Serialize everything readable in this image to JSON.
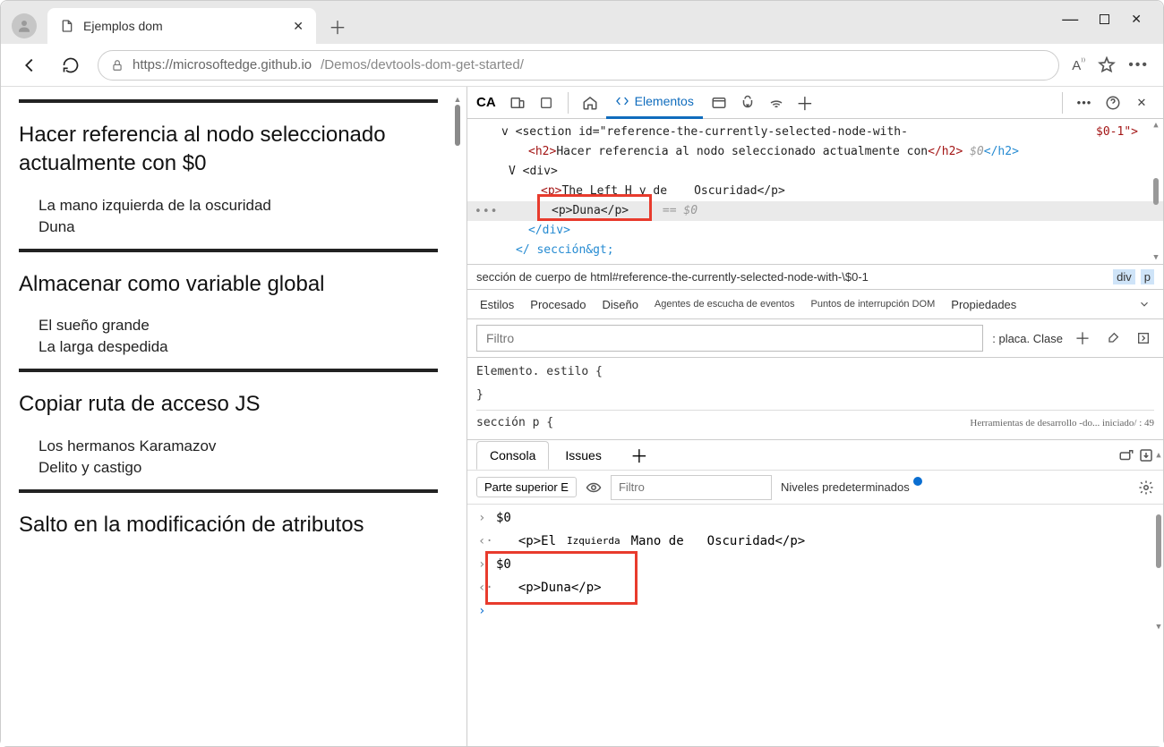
{
  "window": {
    "tab_title": "Ejemplos dom"
  },
  "addressbar": {
    "host": "https://microsoftedge.github.io",
    "path": "/Demos/devtools-dom-get-started/"
  },
  "page": {
    "sections": [
      {
        "heading": "Hacer referencia al nodo seleccionado actualmente con $0",
        "items": [
          "La mano izquierda de la oscuridad",
          "Duna"
        ]
      },
      {
        "heading": "Almacenar como variable global",
        "items": [
          "El sueño grande",
          "La larga despedida"
        ]
      },
      {
        "heading": "Copiar ruta de acceso JS",
        "items": [
          "Los hermanos Karamazov",
          "Delito y castigo"
        ]
      },
      {
        "heading": "Salto en la modificación de atributos",
        "items": []
      }
    ]
  },
  "devtools": {
    "lang": "CA",
    "elements_label": "Elementos",
    "dom": {
      "line1_pre": "v <section id=\"reference-the-currently-selected-node-with-",
      "line1_suffix": "$0-1\">",
      "line2_open": "<h2>",
      "line2_text": "Hacer referencia al nodo seleccionado actualmente con",
      "line2_close": "</h2>",
      "line2_ref": "$0",
      "line2_end": "</h2>",
      "line3": "V <div>",
      "line4_a": "<p>",
      "line4_b": "The_Left_H",
      "line4_c": "y de",
      "line4_d": "Oscuridad</p>",
      "line5": "<p>Duna</p>",
      "line5_ref": "== $0",
      "line6": "</div>",
      "line7": "</ sección&gt;"
    },
    "breadcrumb": {
      "left": "sección de cuerpo de html#reference-the-currently-selected-node-with-\\$0-1",
      "div": "div",
      "p": "p"
    },
    "styles_tabs": {
      "estilos": "Estilos",
      "procesado": "Procesado",
      "diseno": "Diseño",
      "agentes": "Agentes de escucha de eventos",
      "puntos": "Puntos de interrupción DOM",
      "props": "Propiedades"
    },
    "styles": {
      "filter_placeholder": "Filtro",
      "hov_cls": ": placa. Clase",
      "rule1": "Elemento. estilo {",
      "rule1_close": "}",
      "rule2": "sección p {",
      "origin": "Herramientas de desarrollo -do... iniciado/ : 49"
    },
    "drawer": {
      "tab_console": "Consola",
      "tab_issues": "Issues",
      "context": "Parte superior E",
      "filter_placeholder": "Filtro",
      "levels": "Niveles predeterminados",
      "rows": {
        "r1": "$0",
        "r2_a": "<p>El",
        "r2_b": "Izquierda",
        "r2_c": "Mano de",
        "r2_d": "Oscuridad</p>",
        "r3": "$0",
        "r4": "<p>Duna</p>"
      }
    }
  }
}
